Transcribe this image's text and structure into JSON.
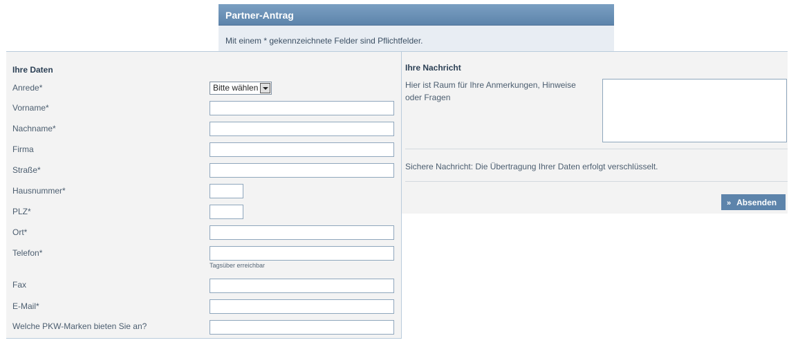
{
  "header": {
    "title": "Partner-Antrag",
    "note": "Mit einem * gekennzeichnete Felder sind Pflichtfelder."
  },
  "left": {
    "section_title": "Ihre Daten",
    "anrede": {
      "label": "Anrede*",
      "selected": "Bitte wählen"
    },
    "vorname": {
      "label": "Vorname*",
      "value": ""
    },
    "nachname": {
      "label": "Nachname*",
      "value": ""
    },
    "firma": {
      "label": "Firma",
      "value": ""
    },
    "strasse": {
      "label": "Straße*",
      "value": ""
    },
    "hausnummer": {
      "label": "Hausnummer*",
      "value": ""
    },
    "plz": {
      "label": "PLZ*",
      "value": ""
    },
    "ort": {
      "label": "Ort*",
      "value": ""
    },
    "telefon": {
      "label": "Telefon*",
      "value": "",
      "hint": "Tagsüber erreichbar"
    },
    "fax": {
      "label": "Fax",
      "value": ""
    },
    "email": {
      "label": "E-Mail*",
      "value": ""
    },
    "pkw": {
      "label": "Welche PKW-Marken bieten Sie an?",
      "value": ""
    }
  },
  "right": {
    "section_title": "Ihre Nachricht",
    "message_label": "Hier ist Raum für Ihre Anmerkungen, Hinweise oder Fragen",
    "message_value": "",
    "secure_text": "Sichere Nachricht: Die Übertragung Ihrer Daten erfolgt verschlüsselt.",
    "submit_icon": "»",
    "submit_label": "Absenden"
  },
  "icons": {
    "dropdown": "chevron-down-icon",
    "submit": "double-chevron-right-icon"
  }
}
